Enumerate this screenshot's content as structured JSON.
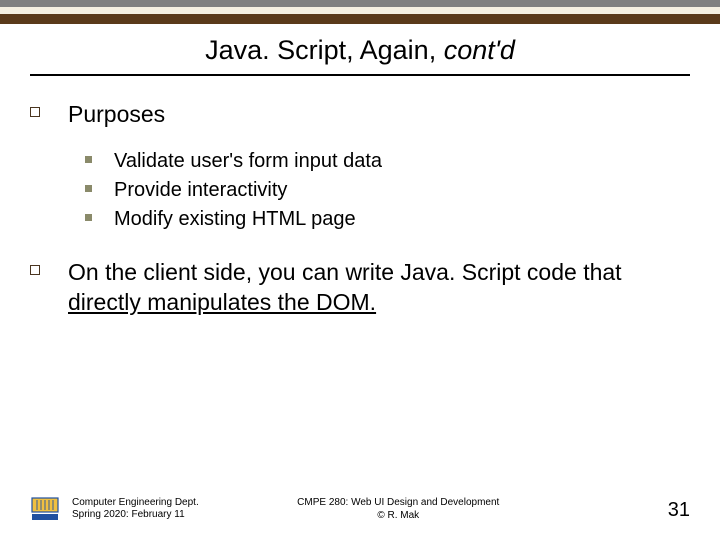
{
  "title": {
    "plain": "Java. Script, Again, ",
    "italic": "cont'd"
  },
  "bullets": [
    {
      "label": "Purposes",
      "children": [
        {
          "label": "Validate user's form input data"
        },
        {
          "label": "Provide interactivity"
        },
        {
          "label": "Modify existing HTML page"
        }
      ]
    },
    {
      "label_pre": "On the client side, you can write Java. Script code that ",
      "label_underlined": "directly manipulates the DOM."
    }
  ],
  "footer": {
    "left": "Computer Engineering Dept.\nSpring 2020: February 11",
    "center": "CMPE 280: Web UI Design and Development\n© R. Mak",
    "page": "31"
  }
}
